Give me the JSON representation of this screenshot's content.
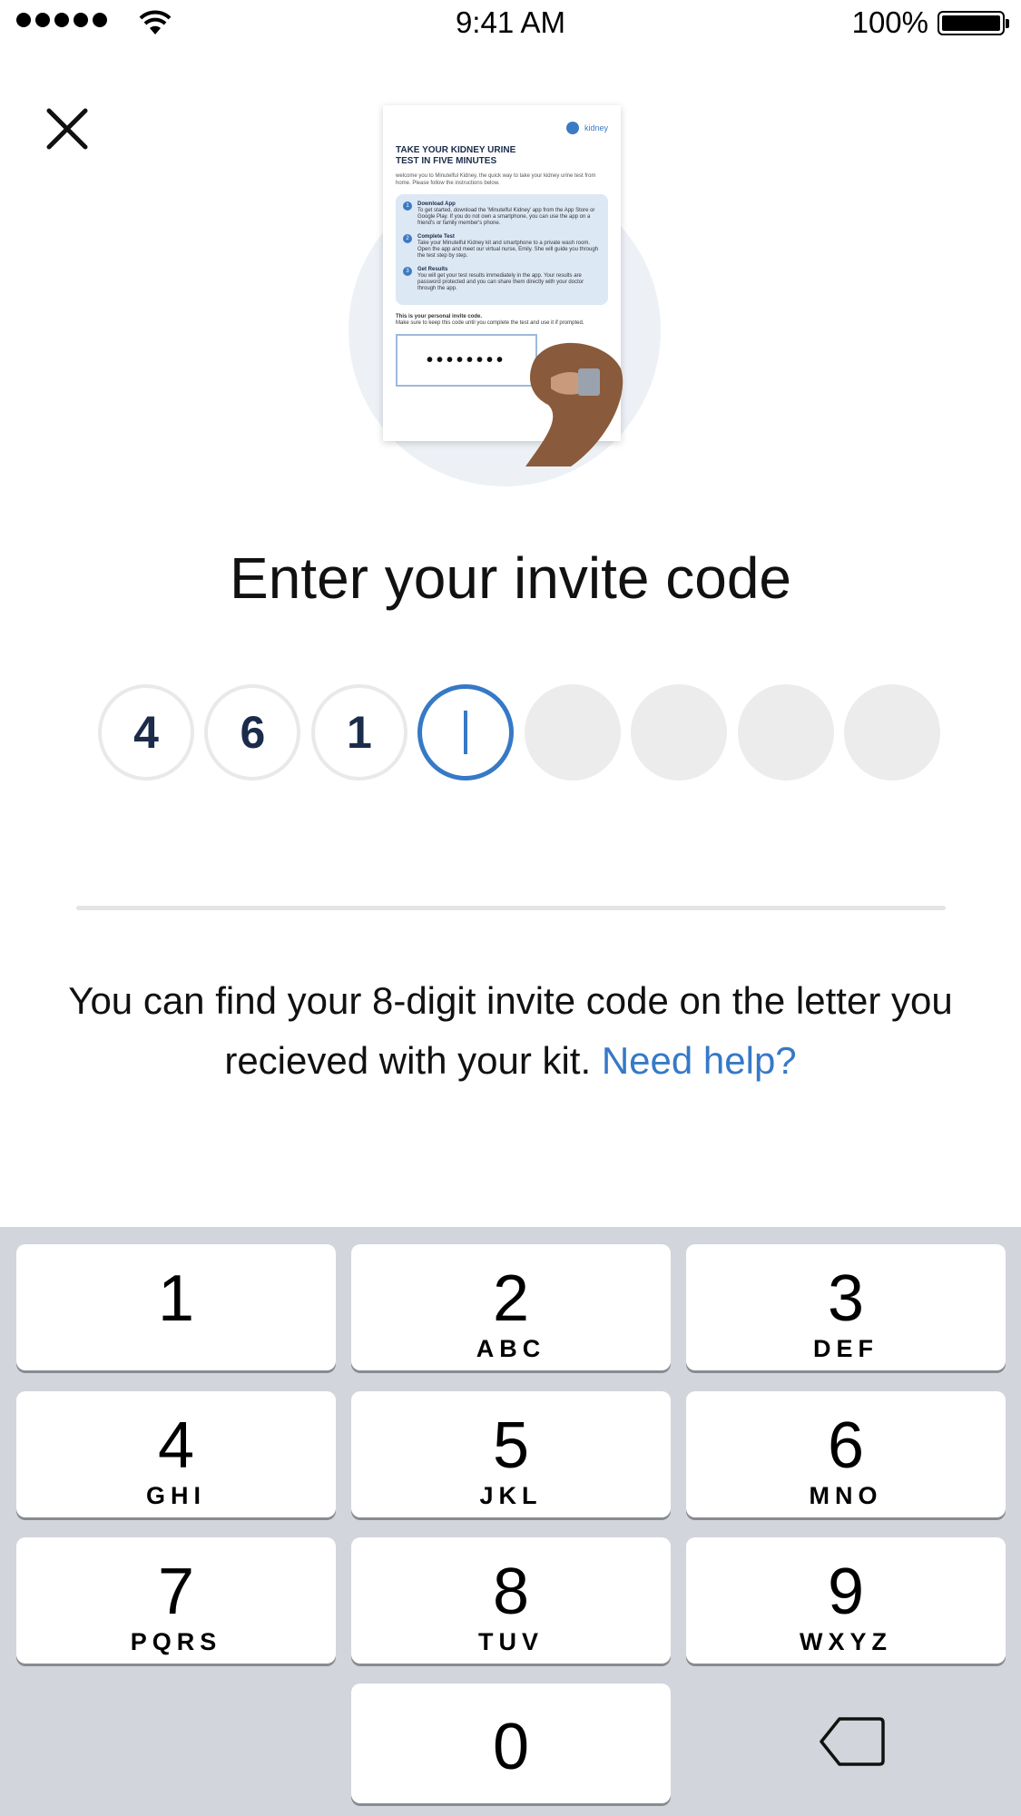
{
  "status_bar": {
    "time": "9:41 AM",
    "battery": "100%"
  },
  "illustration": {
    "logo": "kidney",
    "headline": "TAKE YOUR KIDNEY URINE TEST IN FIVE MINUTES",
    "intro": "welcome you to Minutelful Kidney, the quick way to take your kidney urine test from home. Please follow the instructions below.",
    "steps": [
      {
        "num": "1",
        "title": "Download App",
        "text": "To get started, download the 'Minutelful Kidney' app from the App Store or Google Play. If you do not own a smartphone, you can use the app on a friend's or family member's phone."
      },
      {
        "num": "2",
        "title": "Complete Test",
        "text": "Take your Minutelful Kidney kit and smartphone to a private wash room. Open the app and meet our virtual nurse, Emily. She will guide you through the test step by step."
      },
      {
        "num": "3",
        "title": "Get Results",
        "text": "You will get your test results immediately in the app. Your results are password protected and you can share them directly with your doctor through the app."
      }
    ],
    "code_note_title": "This is your personal invite code.",
    "code_note": "Make sure to keep this code until you complete the test and use it if prompted.",
    "code_mask": "••••••••"
  },
  "title": "Enter your invite code",
  "code": {
    "digits": [
      "4",
      "6",
      "1",
      "",
      "",
      "",
      "",
      ""
    ],
    "active_index": 3
  },
  "help": {
    "text": "You can find your 8-digit invite code on the letter you recieved with your kit. ",
    "link": "Need help?"
  },
  "keypad": {
    "keys": [
      {
        "num": "1",
        "letters": ""
      },
      {
        "num": "2",
        "letters": "ABC"
      },
      {
        "num": "3",
        "letters": "DEF"
      },
      {
        "num": "4",
        "letters": "GHI"
      },
      {
        "num": "5",
        "letters": "JKL"
      },
      {
        "num": "6",
        "letters": "MNO"
      },
      {
        "num": "7",
        "letters": "PQRS"
      },
      {
        "num": "8",
        "letters": "TUV"
      },
      {
        "num": "9",
        "letters": "WXYZ"
      },
      {
        "num": "0",
        "letters": ""
      }
    ]
  }
}
